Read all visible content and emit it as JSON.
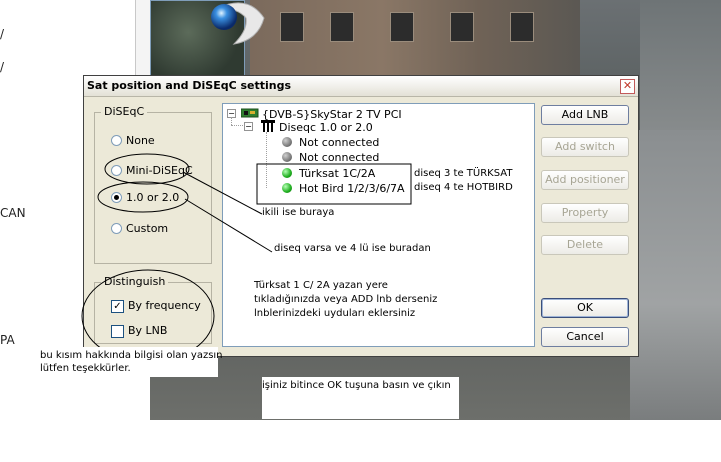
{
  "left_page": {
    "fragments": [
      "/",
      "/",
      "CAN",
      "PA"
    ]
  },
  "dialog": {
    "title": "Sat position and DiSEqC settings",
    "close_glyph": "✕",
    "diseqc_group": {
      "legend": "DiSEqC",
      "options": [
        "None",
        "Mini-DiSEqC",
        "1.0 or 2.0",
        "Custom"
      ],
      "selected": "1.0 or 2.0"
    },
    "distinguish_group": {
      "legend": "Distinguish",
      "options": [
        {
          "label": "By frequency",
          "checked": true
        },
        {
          "label": "By LNB",
          "checked": false
        }
      ]
    },
    "tree": {
      "root": "{DVB-S}SkyStar 2 TV PCI",
      "switch": "Diseqc 1.0 or 2.0",
      "items": [
        {
          "label": "Not connected",
          "status": "grey"
        },
        {
          "label": "Not connected",
          "status": "grey"
        },
        {
          "label": "Türksat 1C/2A",
          "status": "green"
        },
        {
          "label": "Hot Bird 1/2/3/6/7A",
          "status": "green"
        }
      ]
    },
    "buttons": {
      "add_lnb": "Add LNB",
      "add_switch": "Add switch",
      "add_positioner": "Add positioner",
      "property": "Property",
      "delete": "Delete",
      "ok": "OK",
      "cancel": "Cancel"
    }
  },
  "annotations": {
    "diseqc3": "diseq 3 te TÜRKSAT",
    "diseqc4": "diseq 4 te HOTBIRD",
    "ikili": "ikili ise buraya",
    "diseq_varsa": "diseq varsa ve 4 lü ise buradan",
    "instructions": [
      "Türksat 1 C/ 2A yazan yere",
      "tıkladığınızda veya ADD lnb derseniz",
      "lnblerinizdeki uyduları eklersiniz"
    ],
    "bottom_left": [
      "bu kısım hakkında bilgisi olan yazsın",
      "lütfen teşekkürler."
    ],
    "bottom_center": "işiniz bitince OK tuşuna basın ve çıkın"
  }
}
